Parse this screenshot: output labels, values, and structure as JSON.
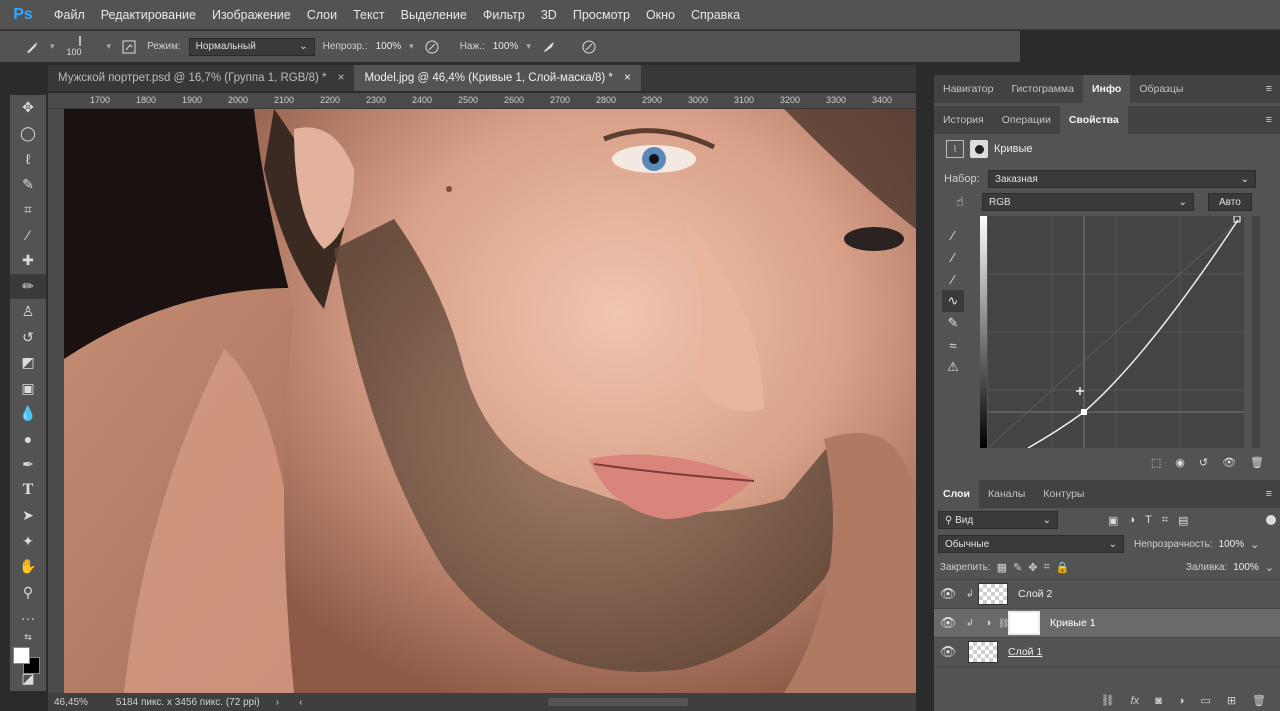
{
  "app": {
    "logo": "Ps"
  },
  "menu": [
    "Файл",
    "Редактирование",
    "Изображение",
    "Слои",
    "Текст",
    "Выделение",
    "Фильтр",
    "3D",
    "Просмотр",
    "Окно",
    "Справка"
  ],
  "options": {
    "brush_size": "100",
    "mode_label": "Режим:",
    "mode_value": "Нормальный",
    "opacity_label": "Непрозр.:",
    "opacity_value": "100%",
    "pressure_label": "Наж.:",
    "pressure_value": "100%"
  },
  "doc_tabs": [
    {
      "label": "Мужской портрет.psd @ 16,7% (Группа 1, RGB/8) *",
      "active": false
    },
    {
      "label": "Model.jpg @ 46,4% (Кривые 1, Слой-маска/8) *",
      "active": true
    }
  ],
  "ruler": [
    "1700",
    "1800",
    "1900",
    "2000",
    "2100",
    "2200",
    "2300",
    "2400",
    "2500",
    "2600",
    "2700",
    "2800",
    "2900",
    "3000",
    "3100",
    "3200",
    "3300",
    "3400"
  ],
  "status": {
    "zoom": "46,45%",
    "doc_info": "5184 пикс. x 3456 пикс. (72 ppi)"
  },
  "panel_top_tabs": [
    "Навигатор",
    "Гистограмма",
    "Инфо",
    "Образцы"
  ],
  "panel_top_active": "Инфо",
  "panel_mid_tabs": [
    "История",
    "Операции",
    "Свойства"
  ],
  "panel_mid_active": "Свойства",
  "properties": {
    "title": "Кривые",
    "preset_label": "Набор:",
    "preset_value": "Заказная",
    "channel_value": "RGB",
    "auto_label": "Авто"
  },
  "layers_tabs": [
    "Слои",
    "Каналы",
    "Контуры"
  ],
  "layers_active": "Слои",
  "layers_panel": {
    "filter_value": "Вид",
    "blend_value": "Обычные",
    "opacity_label": "Непрозрачность:",
    "opacity_value": "100%",
    "lock_label": "Закрепить:",
    "fill_label": "Заливка:",
    "fill_value": "100%"
  },
  "layers": [
    {
      "name": "Слой 2",
      "selected": false
    },
    {
      "name": "Кривые 1",
      "selected": true
    },
    {
      "name": "Слой 1",
      "selected": false
    }
  ],
  "colors": {
    "accent": "#31a8ff",
    "panel": "#535353",
    "dark": "#383838"
  }
}
